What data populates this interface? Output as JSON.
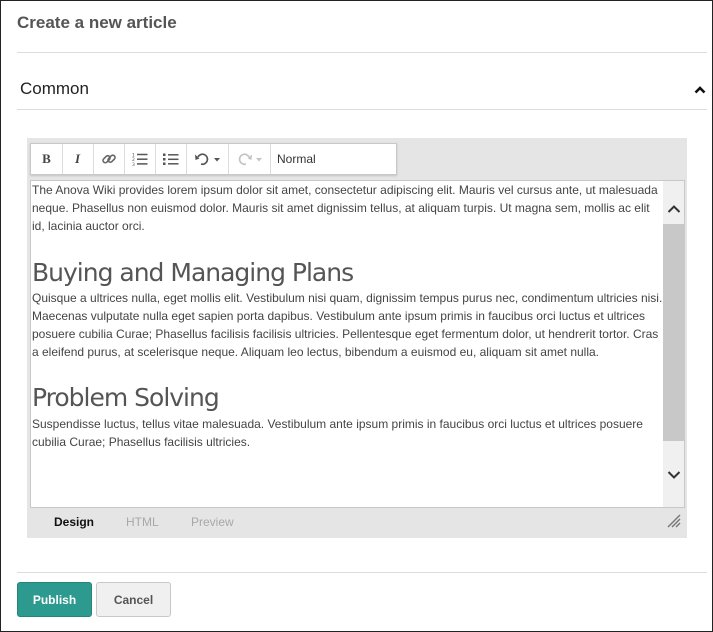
{
  "header": {
    "title": "Create a new article"
  },
  "section": {
    "title": "Common",
    "collapse_icon": "chevron-up-icon"
  },
  "toolbar": {
    "bold_label": "B",
    "italic_label": "I",
    "buttons": [
      "bold",
      "italic",
      "link-icon",
      "ordered-list-icon",
      "unordered-list-icon",
      "undo-icon",
      "redo-icon"
    ],
    "format_value": "Normal"
  },
  "content": {
    "p1": "The Anova Wiki provides lorem ipsum dolor sit amet, consectetur adipiscing elit. Mauris vel cursus ante, ut malesuada neque. Phasellus non euismod dolor. Mauris sit amet dignissim tellus, at aliquam turpis. Ut magna sem, mollis ac elit id, lacinia auctor orci.",
    "h1": "Buying and Managing Plans",
    "p2": "Quisque a ultrices nulla, eget mollis elit. Vestibulum nisi quam, dignissim tempus purus nec, condimentum ultricies nisi. Maecenas vulputate nulla eget sapien porta dapibus. Vestibulum ante ipsum primis in faucibus orci luctus et ultrices posuere cubilia Curae; Phasellus facilisis facilisis ultricies. Pellentesque eget fermentum dolor, ut hendrerit tortor. Cras a eleifend purus, at scelerisque neque. Aliquam leo lectus, bibendum a euismod eu, aliquam sit amet nulla.",
    "h2": "Problem Solving",
    "p3": "Suspendisse luctus, tellus vitae malesuada. Vestibulum ante ipsum primis in faucibus orci luctus et ultrices posuere cubilia Curae; Phasellus facilisis ultricies."
  },
  "tabs": {
    "design": "Design",
    "html": "HTML",
    "preview": "Preview",
    "active": "Design"
  },
  "actions": {
    "publish": "Publish",
    "cancel": "Cancel"
  },
  "colors": {
    "accent": "#2c9a8e",
    "editor_panel": "#e5e5e5",
    "scrollbar_thumb": "#c8c8c8"
  }
}
